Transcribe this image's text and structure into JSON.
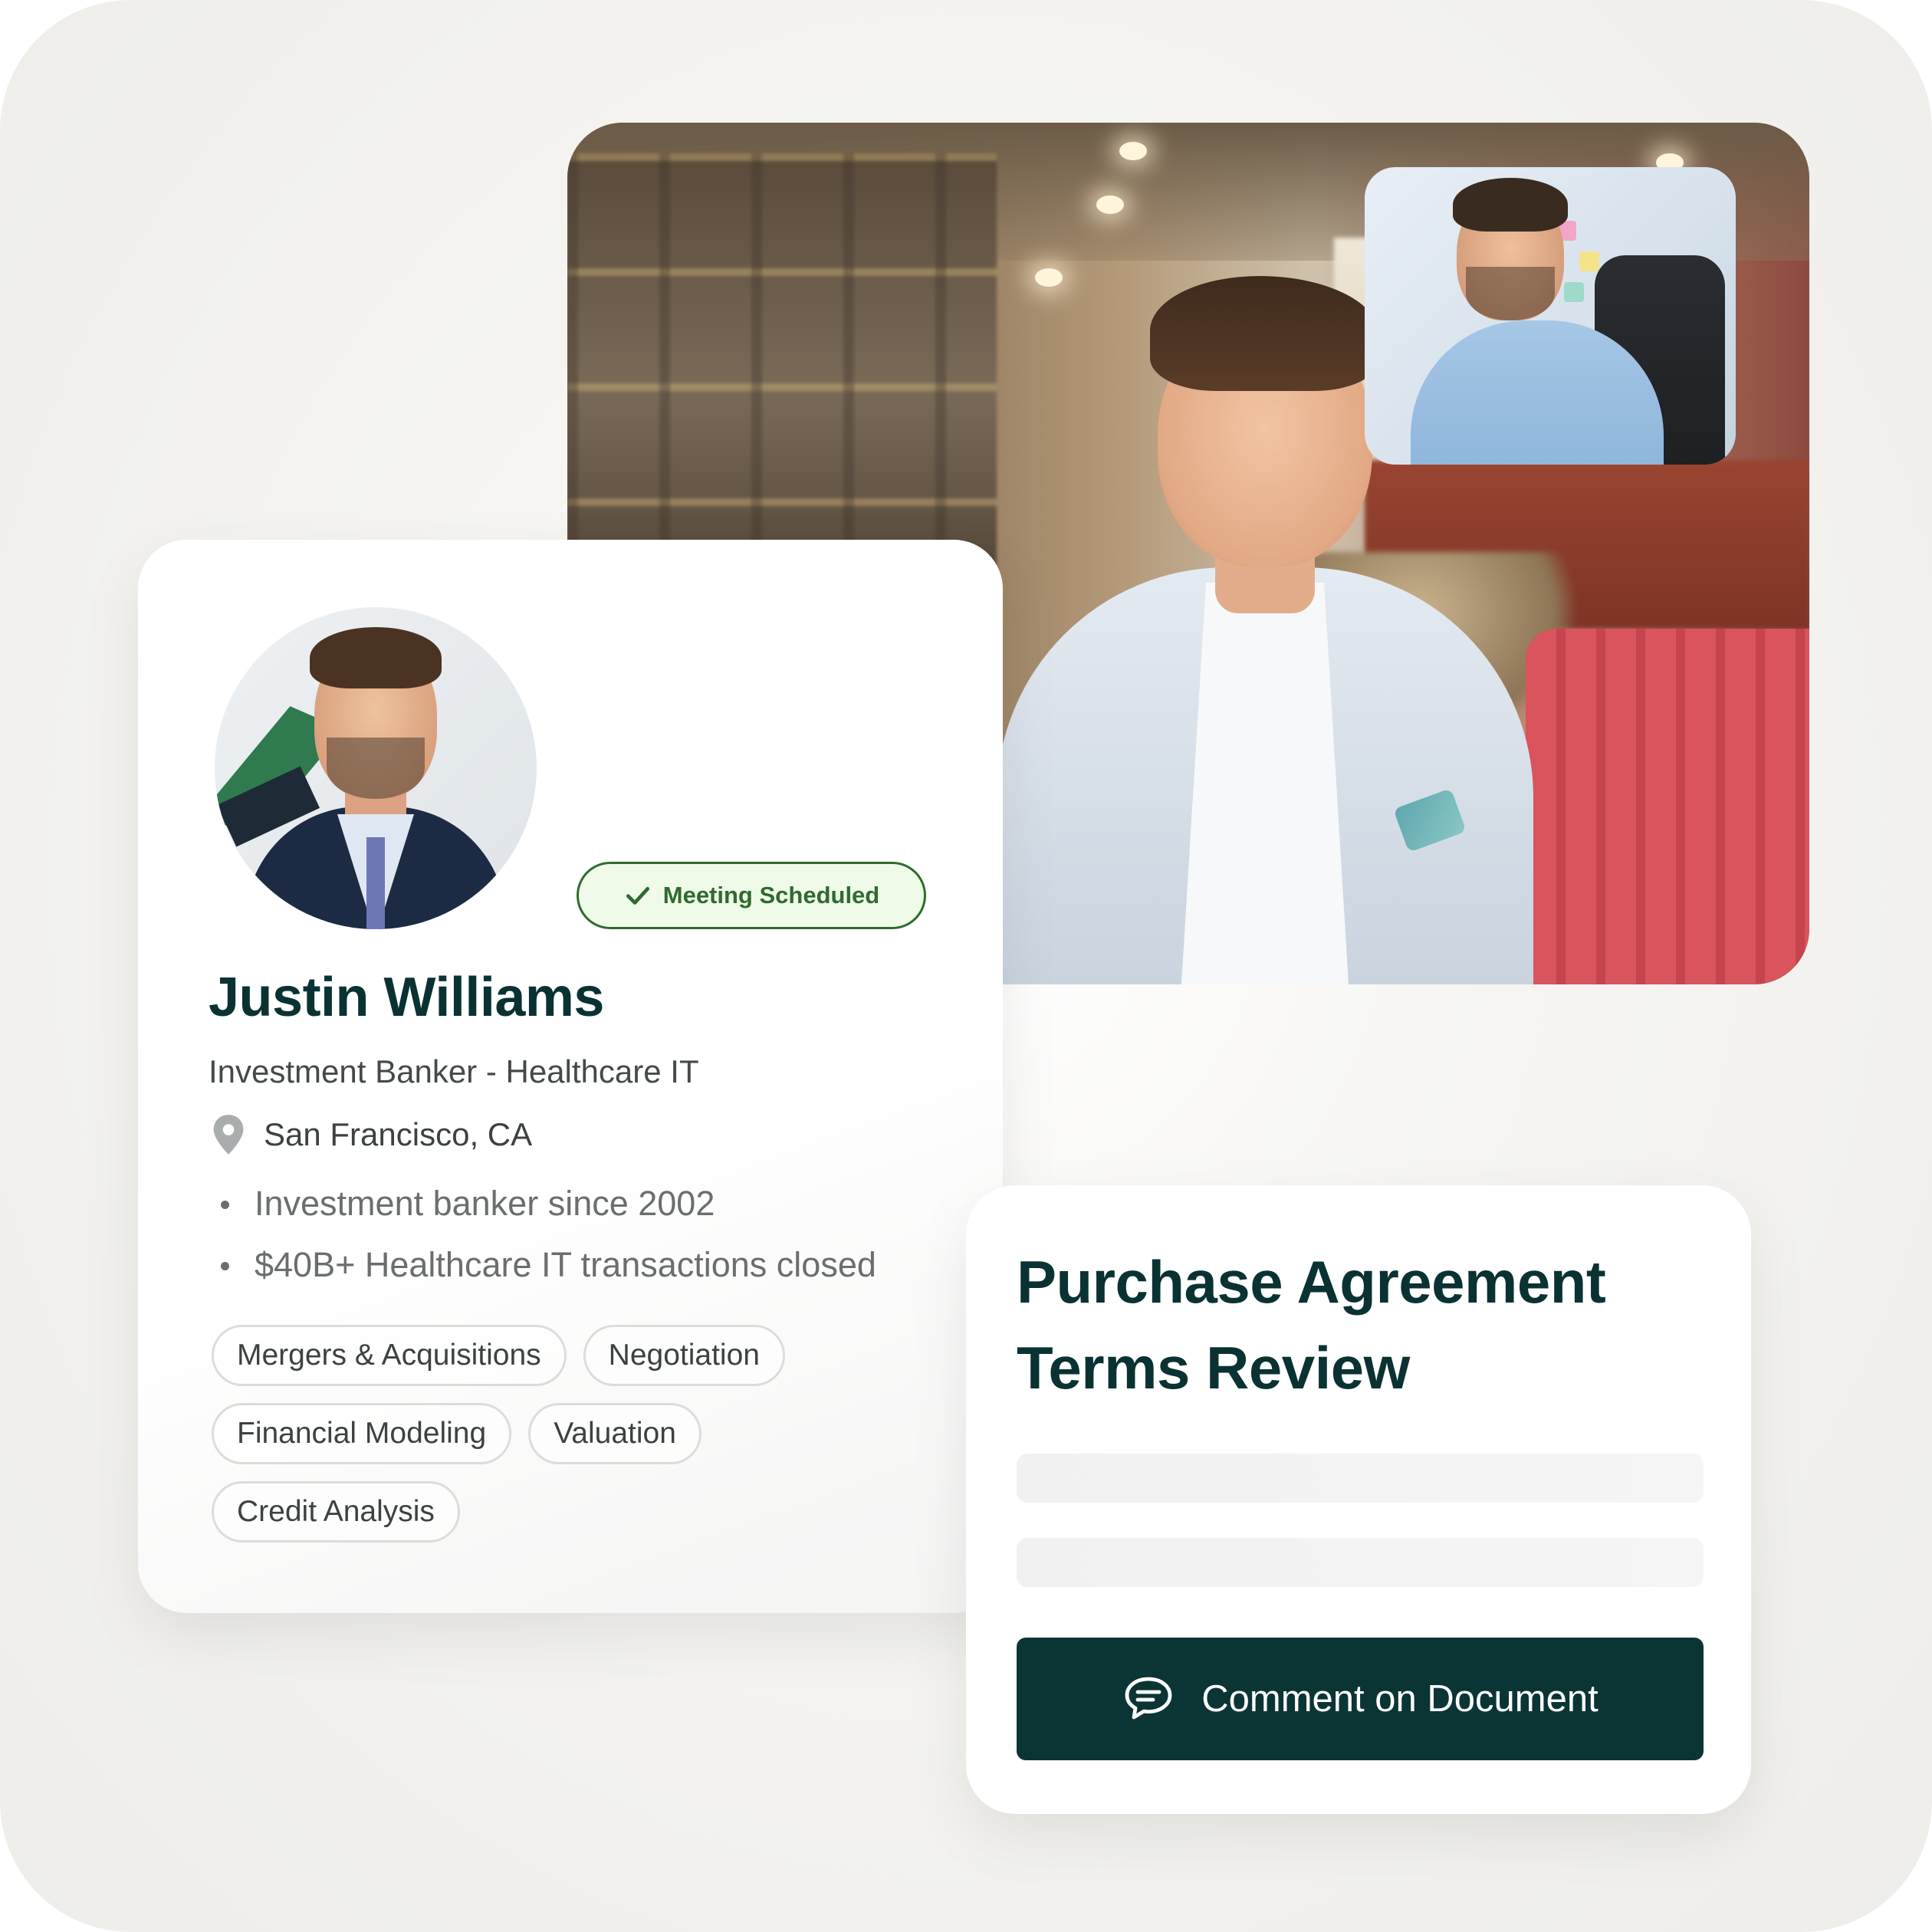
{
  "colors": {
    "brand_dark": "#0b3535",
    "heading": "#0a3232",
    "badge_green": "#2f6b2f",
    "badge_bg": "#effbe8"
  },
  "video_call": {
    "main_participant_icon": "video-feed",
    "pip_participant_icon": "video-feed-thumbnail"
  },
  "profile": {
    "status_badge": {
      "icon": "check-icon",
      "label": "Meeting Scheduled"
    },
    "name": "Justin Williams",
    "title": "Investment Banker - Healthcare IT",
    "location": {
      "icon": "map-pin-icon",
      "text": "San Francisco, CA"
    },
    "highlights": [
      "Investment banker since 2002",
      "$40B+ Healthcare IT transactions closed"
    ],
    "tags": [
      "Mergers & Acquisitions",
      "Negotiation",
      "Financial Modeling",
      "Valuation",
      "Credit Analysis"
    ]
  },
  "document": {
    "title": "Purchase Agreement Terms Review",
    "cta": {
      "icon": "comment-icon",
      "label": "Comment on Document"
    }
  }
}
